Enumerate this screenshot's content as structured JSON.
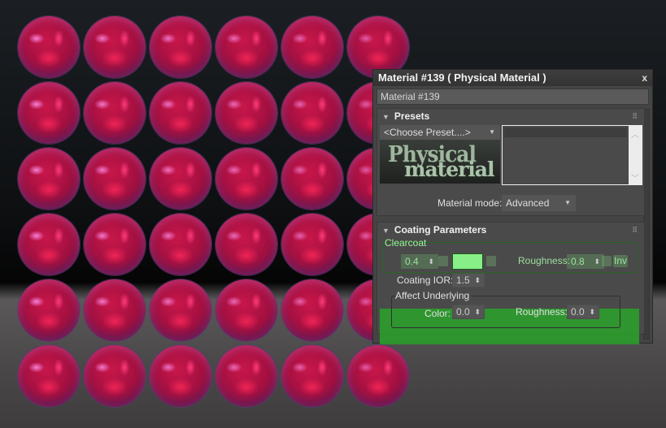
{
  "viewport": {
    "description": "grid of rendered material preview spheres",
    "rows": 6,
    "columns": 6,
    "sphere_color": "#c8164a",
    "highlight_color": "#ff3a7a"
  },
  "dialog": {
    "title": "Material #139  ( Physical Material )",
    "close_label": "x",
    "material_name": "Material #139",
    "presets": {
      "header": "Presets",
      "choose_preset": "<Choose Preset....>",
      "logo_line1": "Physical",
      "logo_line2": "material",
      "material_mode_label": "Material mode:",
      "material_mode_value": "Advanced"
    },
    "coating": {
      "header": "Coating Parameters",
      "clearcoat_group": "Clearcoat",
      "clearcoat_value": "0.4",
      "clearcoat_color": "#88ee88",
      "roughness_label": "Roughness:",
      "roughness_value": "0.8",
      "inv_label": "Inv",
      "coating_ior_label": "Coating IOR:",
      "coating_ior_value": "1.5",
      "affect_group": "Affect Underlying",
      "color_label": "Color:",
      "color_value": "0.0",
      "affect_roughness_label": "Roughness:",
      "affect_roughness_value": "0.0"
    },
    "colors": {
      "highlight_green": "#2aaa2a",
      "panel_bg": "#444444"
    }
  }
}
